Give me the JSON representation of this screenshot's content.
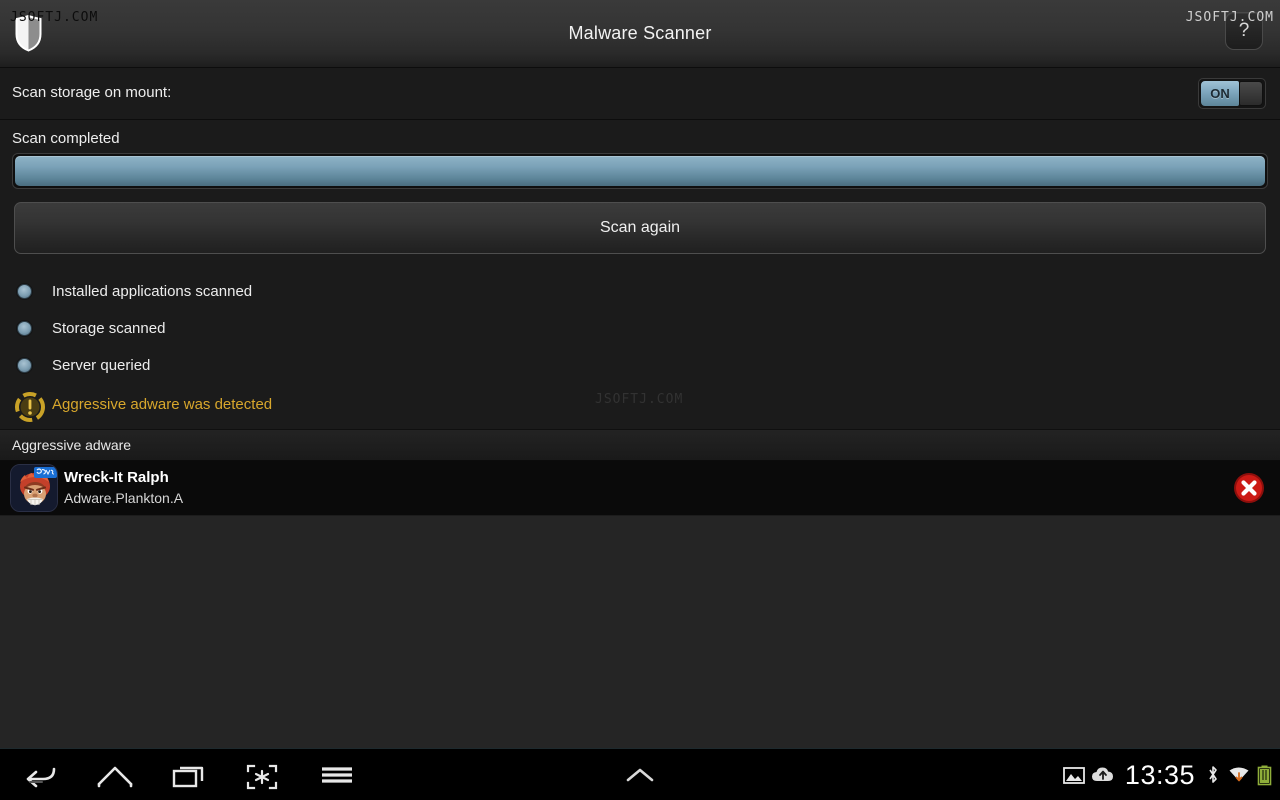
{
  "header": {
    "title": "Malware Scanner",
    "logo_icon": "shield-icon",
    "help_label": "?",
    "help_icon": "question-mark-icon"
  },
  "watermarks": {
    "top_left": "JSOFTJ.COM",
    "top_right": "JSOFTJ.COM",
    "middle": "JSOFTJ.COM"
  },
  "settings": {
    "scan_on_mount_label": "Scan storage on mount:",
    "toggle_state_label": "ON",
    "toggle_on": true
  },
  "scan": {
    "status_text": "Scan completed",
    "progress_percent": 100,
    "scan_again_label": "Scan again"
  },
  "status_list": [
    {
      "label": "Installed applications scanned",
      "icon": "status-dot-icon"
    },
    {
      "label": "Storage scanned",
      "icon": "status-dot-icon"
    },
    {
      "label": "Server queried",
      "icon": "status-dot-icon"
    }
  ],
  "warning": {
    "text": "Aggressive adware was detected",
    "icon": "warning-alert-icon",
    "color": "#d8a72c"
  },
  "section": {
    "title": "Aggressive adware"
  },
  "threats": [
    {
      "name": "Wreck-It Ralph",
      "signature": "Adware.Plankton.A",
      "icon": "app-icon",
      "remove_icon": "remove-circle-icon"
    }
  ],
  "navbar": {
    "buttons": [
      {
        "name": "back",
        "icon": "back-arrow-icon"
      },
      {
        "name": "home",
        "icon": "home-icon"
      },
      {
        "name": "recents",
        "icon": "recent-apps-icon"
      },
      {
        "name": "screenshot",
        "icon": "screenshot-icon"
      },
      {
        "name": "menu",
        "icon": "menu-hamburger-icon"
      }
    ],
    "expand_icon": "chevron-up-icon",
    "status": {
      "clock": "13:35",
      "icons": [
        "gallery-icon",
        "cloud-upload-icon",
        "bluetooth-icon",
        "wifi-icon",
        "battery-icon"
      ]
    }
  },
  "colors": {
    "accent_blue": "#7ba2b8",
    "warning_gold": "#d8a72c",
    "danger_red": "#c21b17",
    "background": "#252525"
  }
}
